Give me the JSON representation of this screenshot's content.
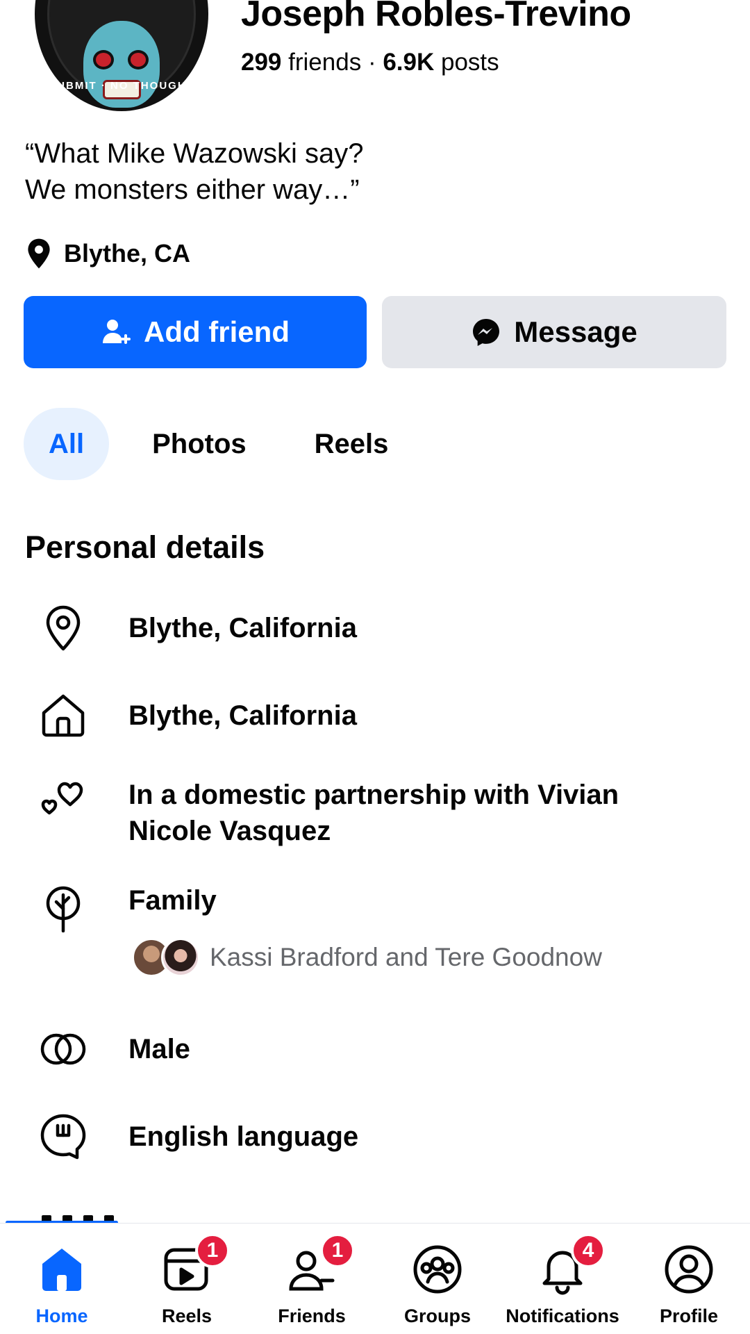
{
  "profile": {
    "name": "Joseph Robles-Trevino",
    "friends_count": "299",
    "friends_label": "friends",
    "separator": "·",
    "posts_count": "6.9K",
    "posts_label": "posts",
    "bio_line1": "“What Mike Wazowski say?",
    "bio_line2": "We monsters either way…”",
    "location": "Blythe, CA",
    "avatar_text": "SUBMIT · NO THOUGHT"
  },
  "actions": {
    "add_friend": "Add friend",
    "message": "Message"
  },
  "tabs": [
    {
      "label": "All",
      "active": true
    },
    {
      "label": "Photos",
      "active": false
    },
    {
      "label": "Reels",
      "active": false
    }
  ],
  "personal_details": {
    "title": "Personal details",
    "current_city": "Blythe, California",
    "hometown": "Blythe, California",
    "relationship_line1": "In a domestic partnership with Vivian",
    "relationship_line2": "Nicole Vasquez",
    "family_label": "Family",
    "family_members": "Kassi Bradford and Tere Goodnow",
    "gender": "Male",
    "language": "English language"
  },
  "bottom_nav": [
    {
      "label": "Home",
      "icon": "home-icon",
      "active": true,
      "badge": null
    },
    {
      "label": "Reels",
      "icon": "reels-icon",
      "active": false,
      "badge": "1"
    },
    {
      "label": "Friends",
      "icon": "friends-icon",
      "active": false,
      "badge": "1"
    },
    {
      "label": "Groups",
      "icon": "groups-icon",
      "active": false,
      "badge": null
    },
    {
      "label": "Notifications",
      "icon": "bell-icon",
      "active": false,
      "badge": "4"
    },
    {
      "label": "Profile",
      "icon": "profile-icon",
      "active": false,
      "badge": null
    }
  ],
  "colors": {
    "accent": "#0866ff",
    "badge": "#e41e3f",
    "secondary_button": "#e4e6eb",
    "active_tab_bg": "#e7f1fe",
    "muted_text": "#65676b"
  }
}
